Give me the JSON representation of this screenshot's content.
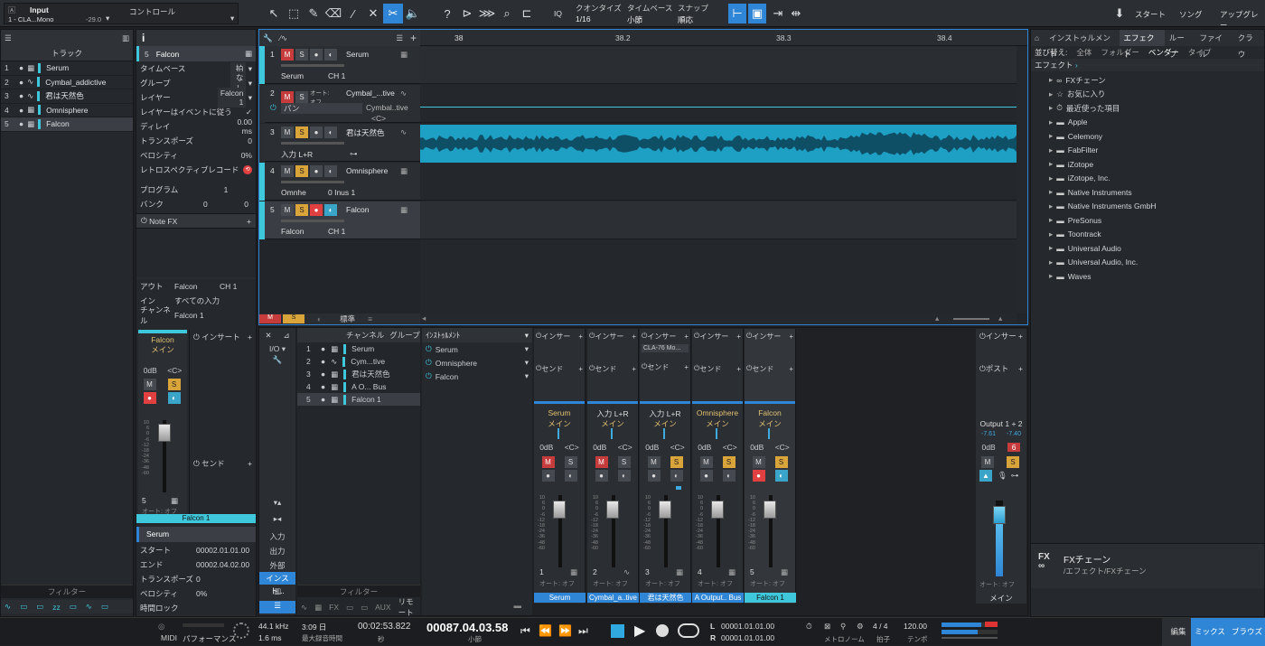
{
  "topbar": {
    "input_label": "Input",
    "input_sub": "1 - CLA...Mono",
    "input_level": "-29.0",
    "control_label": "コントロール",
    "quantize_label": "クオンタイズ",
    "quantize_value": "1/16",
    "timebase_label": "タイムベース",
    "timebase_value": "小節",
    "snap_label": "スナップ",
    "snap_value": "順応",
    "iq_label": "IQ",
    "start": "スタート",
    "song": "ソング",
    "upgrade": "アップグレー"
  },
  "tracklist": {
    "title": "トラック",
    "tracks": [
      {
        "num": "1",
        "name": "Serum"
      },
      {
        "num": "2",
        "name": "Cymbal_addictive"
      },
      {
        "num": "3",
        "name": "君は天然色"
      },
      {
        "num": "4",
        "name": "Omnisphere"
      },
      {
        "num": "5",
        "name": "Falcon"
      }
    ],
    "filter": "フィルター"
  },
  "inspector": {
    "track_num": "5",
    "track_name": "Falcon",
    "rows": [
      {
        "label": "タイムベース",
        "value": "拍"
      },
      {
        "label": "グループ",
        "value": "なし"
      },
      {
        "label": "レイヤー",
        "value": "Falcon 1"
      },
      {
        "label": "レイヤーはイベントに従う",
        "value": "✓"
      },
      {
        "label": "ディレイ",
        "value": "0.00 ms"
      },
      {
        "label": "トランスポーズ",
        "value": "0"
      },
      {
        "label": "ベロシティ",
        "value": "0%"
      },
      {
        "label": "レトロスペクティブレコード",
        "value": ""
      }
    ],
    "program_label": "プログラム",
    "program_value": "1",
    "bank_label": "バンク",
    "bank_v1": "0",
    "bank_v2": "0",
    "notefx": "Note FX",
    "out_label": "アウト",
    "out_value": "Falcon",
    "out_ch": "CH 1",
    "in_label": "イン",
    "in_value": "すべての入力",
    "channel_label": "チャンネル",
    "channel_value": "Falcon 1",
    "ch_name": "Falcon",
    "ch_bus": "メイン",
    "ch_db": "0dB",
    "ch_pan": "<C>",
    "insert_label": "インサート",
    "send_label": "センド",
    "auto_label": "オート: オフ",
    "ch_num": "5",
    "strip_name": "Falcon 1",
    "event_name": "Serum",
    "event_rows": [
      {
        "label": "スタート",
        "value": "00002.01.01.00"
      },
      {
        "label": "エンド",
        "value": "00002.04.02.00"
      },
      {
        "label": "トランスポーズ",
        "value": "0"
      },
      {
        "label": "ベロシティ",
        "value": "0%"
      },
      {
        "label": "時間ロック",
        "value": ""
      }
    ]
  },
  "arrange": {
    "ruler": [
      "38",
      "38.2",
      "38.3",
      "38.4"
    ],
    "tracks": [
      {
        "num": "1",
        "name": "Serum",
        "sub1": "Serum",
        "sub2": "CH 1"
      },
      {
        "num": "2",
        "name": "Cymbal_...tive",
        "sub1": "パン",
        "sub2": "Cymbal..tive",
        "sub3": "<C>",
        "auto": "オート: オフ"
      },
      {
        "num": "3",
        "name": "君は天然色",
        "sub1": "入力 L+R"
      },
      {
        "num": "4",
        "name": "Omnisphere",
        "sub1": "Omnhe",
        "sub2": "0 Inus 1"
      },
      {
        "num": "5",
        "name": "Falcon",
        "sub1": "Falcon",
        "sub2": "CH 1"
      }
    ],
    "footer": "標準"
  },
  "browser": {
    "tabs": [
      "インストゥルメント",
      "エフェクト",
      "ループ",
      "ファイル",
      "クラウ"
    ],
    "sort_label": "並び替え:",
    "sort_options": [
      "全体",
      "フォルダー",
      "ベンダー",
      "タイプ"
    ],
    "crumb": "エフェクト",
    "items": [
      "FXチェーン",
      "お気に入り",
      "最近使った項目",
      "Apple",
      "Celemony",
      "FabFilter",
      "iZotope",
      "iZotope, Inc.",
      "Native Instruments",
      "Native Instruments GmbH",
      "PreSonus",
      "Toontrack",
      "Universal Audio",
      "Universal Audio, Inc.",
      "Waves"
    ],
    "info_title": "FXチェーン",
    "info_path": "/エフェクト/FXチェーン"
  },
  "console": {
    "io_label": "I/O",
    "input_label": "入力",
    "output_label": "出力",
    "external_label": "外部",
    "instrument_label": "インスト...",
    "channel_tab": "チャンネル",
    "group_tab": "グループ",
    "inst_tab": "ｲﾝｽﾄｩﾙﾒﾝﾄ",
    "channels": [
      {
        "num": "1",
        "name": "Serum"
      },
      {
        "num": "2",
        "name": "Cym...tive"
      },
      {
        "num": "3",
        "name": "君は天然色"
      },
      {
        "num": "4",
        "name": "A O... Bus"
      },
      {
        "num": "5",
        "name": "Falcon 1"
      }
    ],
    "instruments": [
      "Serum",
      "Omnisphere",
      "Falcon"
    ],
    "filter": "フィルター",
    "remote": "リモート",
    "strips": [
      {
        "num": "1",
        "input": "Serum",
        "bus": "メイン",
        "name": "Serum",
        "db": "0dB",
        "pan": "<C>"
      },
      {
        "num": "2",
        "input": "入力 L+R",
        "bus": "メイン",
        "name": "Cymbal_a..tive",
        "db": "0dB",
        "pan": "<C>"
      },
      {
        "num": "3",
        "input": "入力 L+R",
        "bus": "メイン",
        "name": "君は天然色",
        "db": "0dB",
        "pan": "<C>",
        "plugin": "CLA-76 Mo..."
      },
      {
        "num": "4",
        "input": "Omnisphere",
        "bus": "メイン",
        "name": "A Output.. Bus",
        "db": "0dB",
        "pan": "<C>"
      },
      {
        "num": "5",
        "input": "Falcon",
        "bus": "メイン",
        "name": "Falcon 1",
        "db": "0dB",
        "pan": "<C>"
      }
    ],
    "insert_label": "インサー",
    "send_label": "センド",
    "auto_label": "オート: オフ",
    "main": {
      "output": "Output 1 + 2",
      "l": "-7.61",
      "r": "-7.40",
      "db": "0dB",
      "peak": "6",
      "name": "メイン",
      "insert": "インサー",
      "post": "ポスト"
    }
  },
  "transport": {
    "midi": "MIDI",
    "perf": "パフォーマンス",
    "rate": "44.1 kHz",
    "latency": "1.6 ms",
    "rec_time": "3:09 日",
    "rec_label": "最大録音時間",
    "time": "00:02:53.822",
    "time_label": "秒",
    "position": "00087.04.03.58",
    "position_label": "小節",
    "l_pos": "00001.01.01.00",
    "r_pos": "00001.01.01.00",
    "metronome": "メトロノーム",
    "sig": "4 / 4",
    "sig_label": "拍子",
    "tempo": "120.00",
    "tempo_label": "テンポ",
    "edit": "編集",
    "mix": "ミックス",
    "browse": "ブラウズ"
  }
}
